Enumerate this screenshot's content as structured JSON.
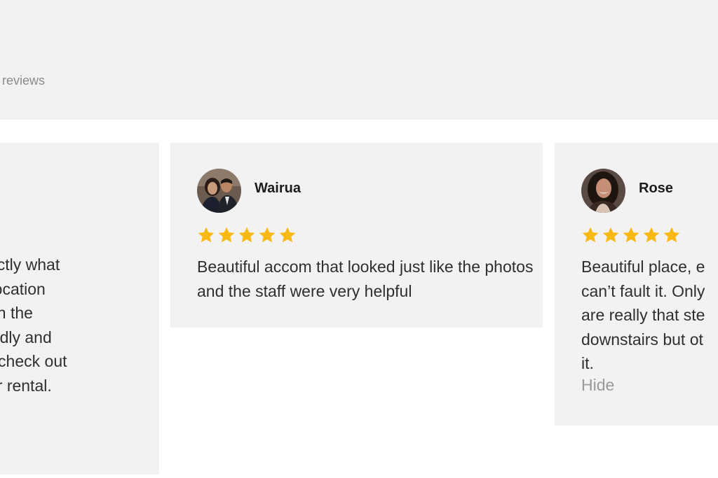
{
  "header": {
    "reviews_label": "reviews"
  },
  "reviews": {
    "left": {
      "lines": [
        "as exactly what",
        "d the location",
        "being in the",
        "re friendly and",
        "in and check out",
        "scooter rental."
      ]
    },
    "middle": {
      "name": "Wairua",
      "rating": 5,
      "text": "Beautiful accom that looked just like the photos and the staff were very helpful"
    },
    "right": {
      "name": "Rose",
      "rating": 5,
      "lines": [
        "Beautiful place, e",
        "can’t fault it. Only",
        "are really that ste",
        "downstairs but ot",
        "it."
      ],
      "hide_label": "Hide"
    }
  },
  "colors": {
    "star": "#f9b914",
    "card_background": "#f2f2f2",
    "muted_text": "#9a9a9a"
  }
}
